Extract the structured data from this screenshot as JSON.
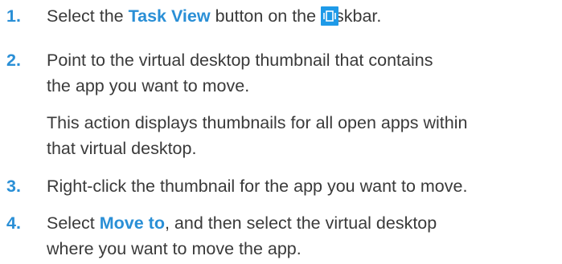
{
  "steps": [
    {
      "number": "1.",
      "pre": "Select the ",
      "keyword": "Task View",
      "post": " button on the taskbar.",
      "icon": "task-view-icon"
    },
    {
      "number": "2.",
      "lines": [
        "Point to the virtual desktop thumbnail that contains",
        "the app you want to move."
      ],
      "note_lines": [
        "This action displays thumbnails for all open apps within",
        "that virtual desktop."
      ]
    },
    {
      "number": "3.",
      "text": "Right-click the thumbnail for the app you want to move."
    },
    {
      "number": "4.",
      "pre": "Select ",
      "keyword": "Move to",
      "post": ", and then select the virtual desktop",
      "line2": "where you want to move the app."
    }
  ],
  "colors": {
    "accent": "#2a8fd6",
    "text": "#3a3a3a",
    "icon_bg": "#1e9ae8"
  }
}
